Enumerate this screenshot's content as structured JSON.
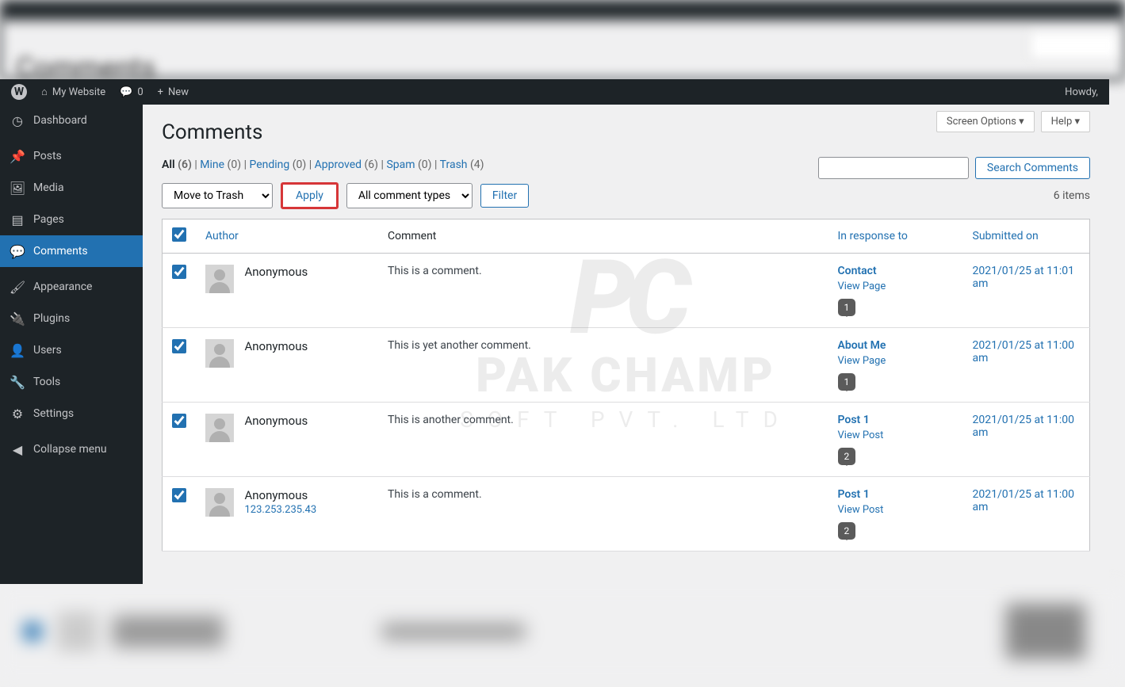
{
  "blurTitle": "Comments",
  "adminBar": {
    "siteName": "My Website",
    "commentCount": "0",
    "newLabel": "New",
    "howdy": "Howdy,"
  },
  "sidebar": {
    "items": [
      {
        "icon": "dashboard",
        "label": "Dashboard"
      },
      {
        "icon": "posts",
        "label": "Posts"
      },
      {
        "icon": "media",
        "label": "Media"
      },
      {
        "icon": "pages",
        "label": "Pages"
      },
      {
        "icon": "comments",
        "label": "Comments",
        "active": true
      },
      {
        "icon": "appearance",
        "label": "Appearance"
      },
      {
        "icon": "plugins",
        "label": "Plugins"
      },
      {
        "icon": "users",
        "label": "Users"
      },
      {
        "icon": "tools",
        "label": "Tools"
      },
      {
        "icon": "settings",
        "label": "Settings"
      },
      {
        "icon": "collapse",
        "label": "Collapse menu"
      }
    ]
  },
  "screenOptions": "Screen Options",
  "help": "Help",
  "pageTitle": "Comments",
  "filters": {
    "all": {
      "label": "All",
      "count": "(6)"
    },
    "mine": {
      "label": "Mine",
      "count": "(0)"
    },
    "pending": {
      "label": "Pending",
      "count": "(0)"
    },
    "approved": {
      "label": "Approved",
      "count": "(6)"
    },
    "spam": {
      "label": "Spam",
      "count": "(0)"
    },
    "trash": {
      "label": "Trash",
      "count": "(4)"
    }
  },
  "bulkAction": "Move to Trash",
  "applyLabel": "Apply",
  "commentTypes": "All comment types",
  "filterLabel": "Filter",
  "itemsCount": "6 items",
  "searchPlaceholder": "",
  "searchBtn": "Search Comments",
  "columns": {
    "author": "Author",
    "comment": "Comment",
    "response": "In response to",
    "date": "Submitted on"
  },
  "rows": [
    {
      "author": "Anonymous",
      "ip": "",
      "comment": "This is a comment.",
      "responseTitle": "Contact",
      "viewLabel": "View Page",
      "bubble": "1",
      "date": "2021/01/25 at 11:01 am"
    },
    {
      "author": "Anonymous",
      "ip": "",
      "comment": "This is yet another comment.",
      "responseTitle": "About Me",
      "viewLabel": "View Page",
      "bubble": "1",
      "date": "2021/01/25 at 11:00 am"
    },
    {
      "author": "Anonymous",
      "ip": "",
      "comment": "This is another comment.",
      "responseTitle": "Post 1",
      "viewLabel": "View Post",
      "bubble": "2",
      "date": "2021/01/25 at 11:00 am"
    },
    {
      "author": "Anonymous",
      "ip": "123.253.235.43",
      "comment": "This is a comment.",
      "responseTitle": "Post 1",
      "viewLabel": "View Post",
      "bubble": "2",
      "date": "2021/01/25 at 11:00 am"
    }
  ],
  "watermark": {
    "logo": "PC",
    "text": "PAK CHAMP",
    "sub": "SOFT PVT. LTD"
  }
}
